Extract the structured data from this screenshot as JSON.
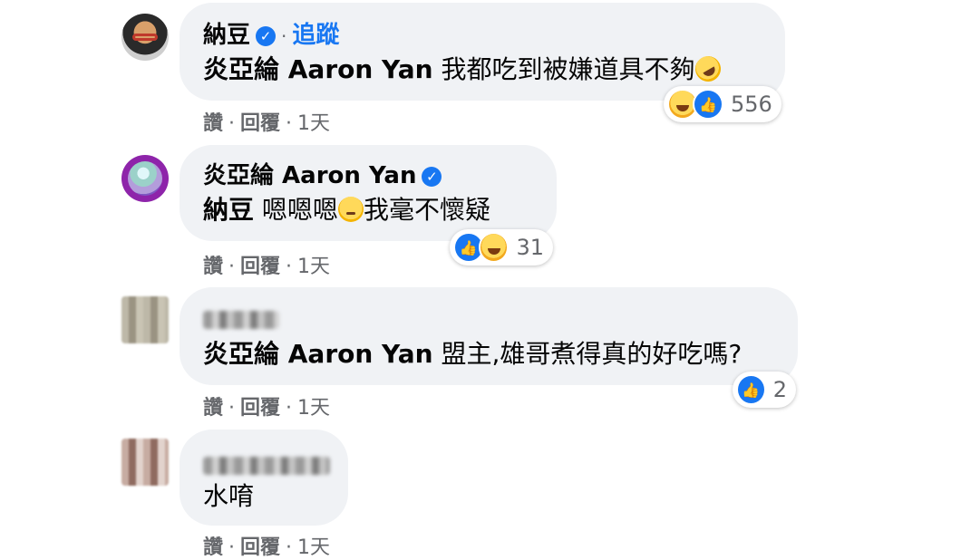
{
  "comments": [
    {
      "name": "納豆",
      "verified": true,
      "follow_label": "追蹤",
      "tag": "炎亞綸 Aaron Yan",
      "text": "我都吃到被嫌道具不夠",
      "reactions": {
        "icons": [
          "haha-icon",
          "like-icon"
        ],
        "count": "556"
      },
      "actions": {
        "like": "讚",
        "reply": "回覆",
        "time": "1天"
      }
    },
    {
      "name": "炎亞綸 Aaron Yan",
      "verified": true,
      "tag": "納豆",
      "text": "嗯嗯嗯",
      "text_after": "我毫不懷疑",
      "reactions": {
        "icons": [
          "like-icon",
          "haha-icon"
        ],
        "count": "31"
      },
      "actions": {
        "like": "讚",
        "reply": "回覆",
        "time": "1天"
      }
    },
    {
      "name_blurred": true,
      "tag": "炎亞綸 Aaron Yan",
      "text": "盟主,雄哥煮得真的好吃嗎?",
      "reactions": {
        "icons": [
          "like-icon"
        ],
        "count": "2"
      },
      "actions": {
        "like": "讚",
        "reply": "回覆",
        "time": "1天"
      }
    },
    {
      "name_blurred": true,
      "text": "水唷",
      "actions": {
        "like": "讚",
        "reply": "回覆",
        "time": "1天"
      }
    }
  ],
  "colors": {
    "bubble": "#f0f2f5",
    "link": "#1877f2",
    "meta": "#65676b"
  }
}
